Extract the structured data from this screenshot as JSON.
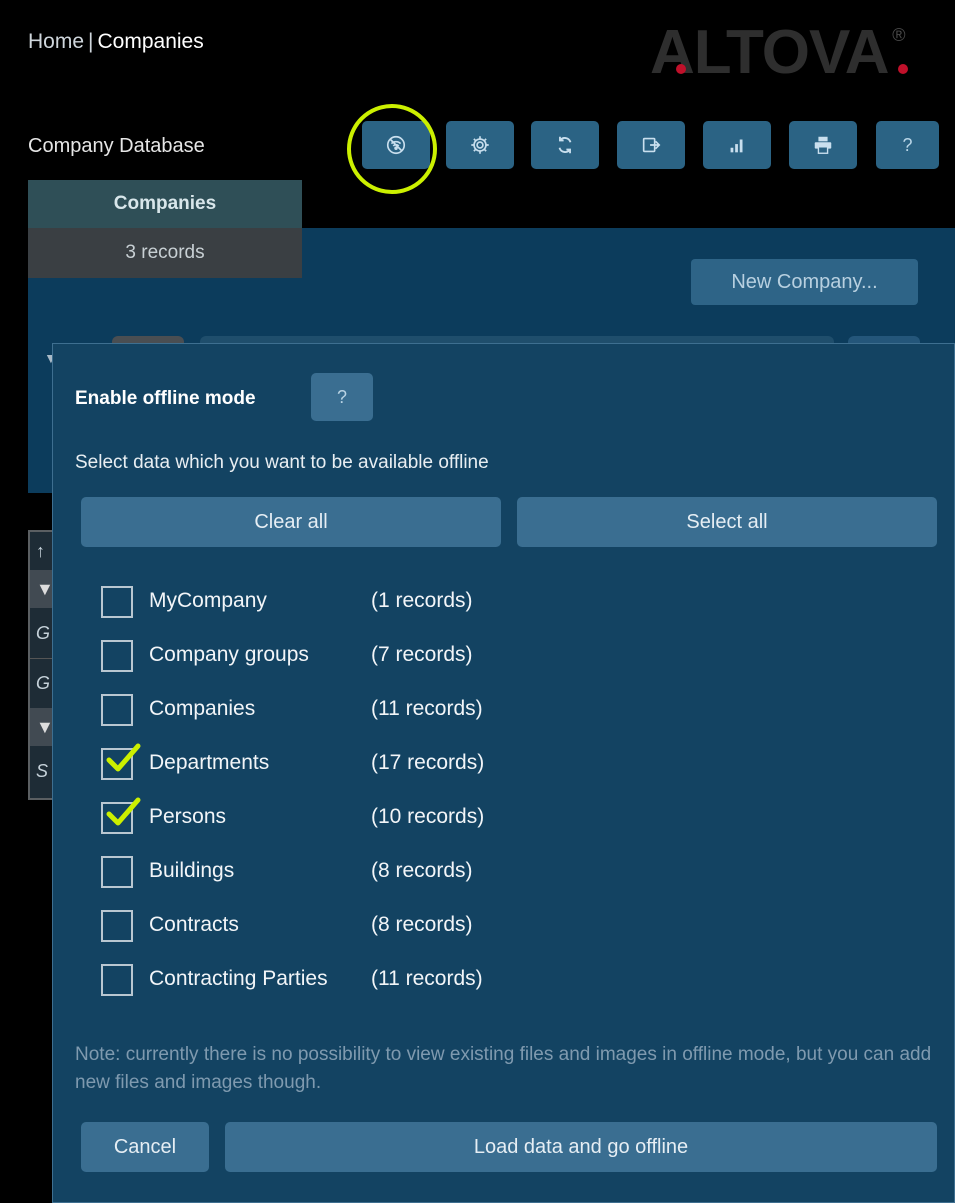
{
  "breadcrumb": {
    "home": "Home",
    "separator": "|",
    "current": "Companies"
  },
  "logo": {
    "text": "ALTOVA",
    "reg": "®"
  },
  "database_title": "Company Database",
  "toolbar": {
    "buttons": [
      {
        "icon": "offline-icon"
      },
      {
        "icon": "gear-icon"
      },
      {
        "icon": "refresh-icon"
      },
      {
        "icon": "export-icon"
      },
      {
        "icon": "chart-icon"
      },
      {
        "icon": "print-icon"
      },
      {
        "icon": "help-icon",
        "label": "?"
      }
    ],
    "highlight_color": "#ccf000"
  },
  "tabs": {
    "active_label": "Companies",
    "count_label": "3 records"
  },
  "new_company_label": "New Company...",
  "background_rows": [
    "↑",
    "▼",
    "G",
    "G",
    "▼",
    "S"
  ],
  "dialog": {
    "title": "Enable offline mode",
    "help_label": "?",
    "subtitle": "Select data which you want to be available offline",
    "clear_all": "Clear all",
    "select_all": "Select all",
    "items": [
      {
        "label": "MyCompany",
        "count": "(1 records)",
        "checked": false
      },
      {
        "label": "Company groups",
        "count": "(7 records)",
        "checked": false
      },
      {
        "label": "Companies",
        "count": "(11 records)",
        "checked": false
      },
      {
        "label": "Departments",
        "count": "(17 records)",
        "checked": true
      },
      {
        "label": "Persons",
        "count": "(10 records)",
        "checked": true
      },
      {
        "label": "Buildings",
        "count": "(8 records)",
        "checked": false
      },
      {
        "label": "Contracts",
        "count": "(8 records)",
        "checked": false
      },
      {
        "label": "Contracting Parties",
        "count": "(11 records)",
        "checked": false
      }
    ],
    "note": "Note: currently there is no possibility to view existing files and images in offline mode, but you can add new files and images though.",
    "cancel": "Cancel",
    "go_offline": "Load data and go offline"
  },
  "colors": {
    "accent": "#3a6e91",
    "check": "#ccf000",
    "panel": "#134362"
  }
}
